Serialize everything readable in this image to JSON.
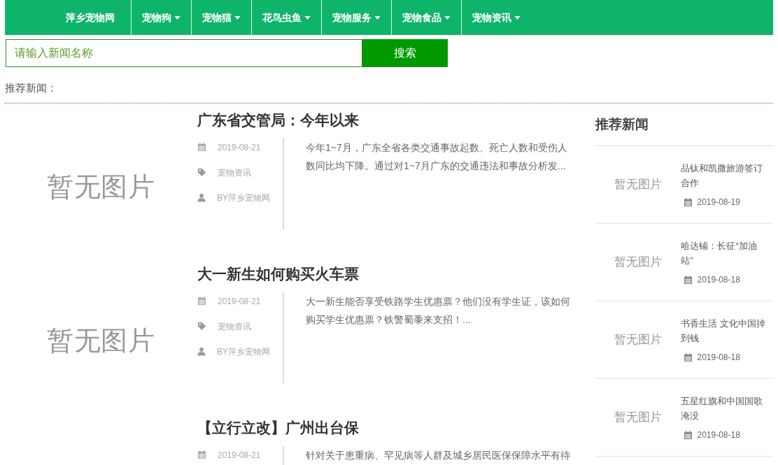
{
  "nav": {
    "brand": "萍乡宠物网",
    "items": [
      {
        "label": "宠物狗",
        "dropdown": true
      },
      {
        "label": "宠物猫",
        "dropdown": true
      },
      {
        "label": "花鸟虫鱼",
        "dropdown": true
      },
      {
        "label": "宠物服务",
        "dropdown": true
      },
      {
        "label": "宠物食品",
        "dropdown": true
      },
      {
        "label": "宠物资讯",
        "dropdown": true
      }
    ]
  },
  "search": {
    "placeholder": "请输入新闻名称",
    "button": "搜索"
  },
  "section_label": "推荐新闻：",
  "articles": [
    {
      "image_text": "暂无图片",
      "title": "广东省交管局：今年以来",
      "date": "2019-08-21",
      "category": "宠物资讯",
      "author": "BY萍乡宠物网",
      "excerpt": "今年1~7月，广东全省各类交通事故起数、死亡人数和受伤人数同比均下降。通过对1~7月广东的交通违法和事故分析发..."
    },
    {
      "image_text": "暂无图片",
      "title": "大一新生如何购买火车票",
      "date": "2019-08-21",
      "category": "宠物资讯",
      "author": "BY萍乡宠物网",
      "excerpt": "大一新生能否享受铁路学生优惠票？他们没有学生证，该如何购买学生优惠票？铁警蜀黍来支招！..."
    },
    {
      "title": "【立行立改】广州出台保",
      "date": "2019-08-21",
      "excerpt": "针对关于患重病、罕见病等人群及城乡居民医保保障水平有待"
    }
  ],
  "sidebar": {
    "title": "推荐新闻",
    "items": [
      {
        "image_text": "暂无图片",
        "title": "品钛和凯撒旅游签订合作",
        "date": "2019-08-19"
      },
      {
        "image_text": "暂无图片",
        "title": "哈达铺：长征“加油站”",
        "date": "2019-08-18"
      },
      {
        "image_text": "暂无图片",
        "title": "书香生活 文化中国掉到钱",
        "date": "2019-08-18"
      },
      {
        "image_text": "暂无图片",
        "title": "五星红旗和中国国歌淹没",
        "date": "2019-08-18"
      }
    ]
  }
}
